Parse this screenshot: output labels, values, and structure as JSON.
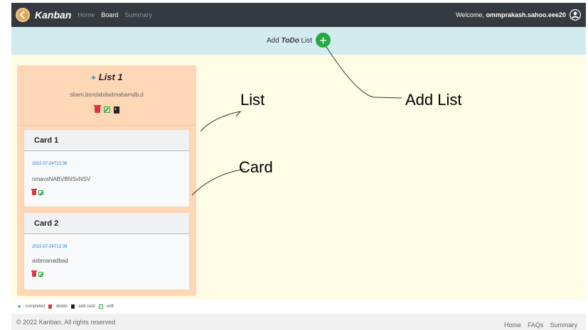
{
  "navbar": {
    "brand": "Kanban",
    "links": [
      {
        "label": "Home",
        "active": false
      },
      {
        "label": "Board",
        "active": true
      },
      {
        "label": "Summary",
        "active": false
      }
    ],
    "welcome_prefix": "Welcome,",
    "username": "ommprakash.sahoo.eee20",
    "background": "#343a40"
  },
  "add_bar": {
    "label_prefix": "Add",
    "label_emph": "ToDo",
    "label_suffix": "List",
    "button_symbol": "+",
    "background": "#d1ebef",
    "button_color": "#28a745"
  },
  "list": {
    "title": "List 1",
    "description": "sbam,bsndabdadmabamdb,d",
    "background": "#fed7b7",
    "cards": [
      {
        "title": "Card 1",
        "date": "2022-07-24T12:36",
        "text": "nmavsNABVBNSvNSV"
      },
      {
        "title": "Card 2",
        "date": "2022-07-24T12:39",
        "text": "asbmanadbad"
      }
    ]
  },
  "legend": {
    "completed": ": completed",
    "delete": ": delete",
    "add_card": ": add card",
    "edit": ": edit"
  },
  "footer": {
    "copyright": "© 2022 Kanban, All rights reserved",
    "links": [
      "Home",
      "FAQs",
      "Summary"
    ]
  },
  "annotations": {
    "list": "List",
    "card": "Card",
    "add_list": "Add List"
  },
  "icons": {
    "brand": "kanban-logo-icon",
    "user": "user-circle-icon",
    "add": "plus-circle-icon",
    "completed": "star-icon",
    "delete": "trash-icon",
    "edit": "edit-icon",
    "add_card": "file-plus-icon"
  }
}
